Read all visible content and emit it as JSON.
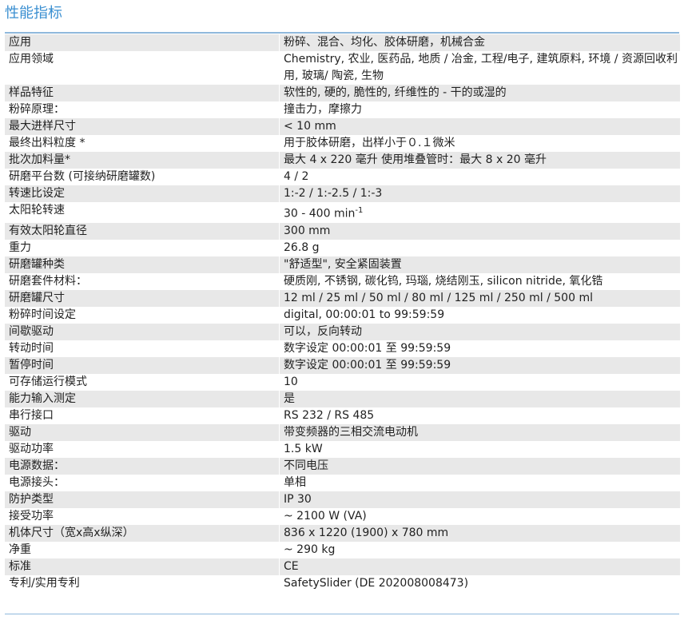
{
  "title": "性能指标",
  "rows": [
    {
      "label": "应用",
      "value": "粉碎、混合、均化、胶体研磨，机械合金"
    },
    {
      "label": "应用领域",
      "value": "Chemistry, 农业, 医药品, 地质 / 冶金, 工程/电子, 建筑原料, 环境 / 资源回收利用, 玻璃/ 陶瓷, 生物"
    },
    {
      "label": "样品特征",
      "value": "软性的, 硬的, 脆性的, 纤维性的 - 干的或湿的"
    },
    {
      "label": "粉碎原理：",
      "value": "撞击力，摩擦力"
    },
    {
      "label": "最大进样尺寸",
      "value": "< 10 mm"
    },
    {
      "label": "最终出料粒度 *",
      "value": "用于胶体研磨，出样小于０.１微米"
    },
    {
      "label": "批次加料量*",
      "value": "最大 4 x 220 毫升 使用堆叠管时：最大 8 x 20 毫升"
    },
    {
      "label": "研磨平台数 (可接纳研磨罐数)",
      "value": "4 / 2"
    },
    {
      "label": "转速比设定",
      "value": "1:-2 / 1:-2.5 / 1:-3"
    },
    {
      "label": "太阳轮转速",
      "value": "30 - 400 min",
      "sup": "-1"
    },
    {
      "label": "有效太阳轮直径",
      "value": "300 mm"
    },
    {
      "label": "重力",
      "value": "26.8 g"
    },
    {
      "label": "研磨罐种类",
      "value": "\"舒适型\", 安全紧固装置"
    },
    {
      "label": "研磨套件材料：",
      "value": "硬质刚, 不锈钢, 碳化钨, 玛瑙, 烧结刚玉, silicon nitride, 氧化锆"
    },
    {
      "label": "研磨罐尺寸",
      "value": "12 ml / 25 ml / 50 ml / 80 ml / 125 ml / 250 ml / 500 ml"
    },
    {
      "label": "粉碎时间设定",
      "value": "digital, 00:00:01 to 99:59:59"
    },
    {
      "label": "间歇驱动",
      "value": "可以，反向转动"
    },
    {
      "label": "转动时间",
      "value": "数字设定 00:00:01 至 99:59:59"
    },
    {
      "label": "暂停时间",
      "value": "数字设定 00:00:01 至 99:59:59"
    },
    {
      "label": "可存储运行模式",
      "value": "10"
    },
    {
      "label": "能力输入测定",
      "value": "是"
    },
    {
      "label": "串行接口",
      "value": "RS 232 / RS 485"
    },
    {
      "label": "驱动",
      "value": "带变频器的三相交流电动机"
    },
    {
      "label": "驱动功率",
      "value": "1.5 kW"
    },
    {
      "label": "电源数据：",
      "value": "不同电压"
    },
    {
      "label": "电源接头：",
      "value": "单相"
    },
    {
      "label": "防护类型",
      "value": "IP 30"
    },
    {
      "label": "接受功率",
      "value": "~ 2100 W (VA)"
    },
    {
      "label": "机体尺寸（宽x高x纵深）",
      "value": "836 x 1220 (1900) x 780 mm"
    },
    {
      "label": "净重",
      "value": "~ 290 kg"
    },
    {
      "label": "标准",
      "value": "CE"
    },
    {
      "label": "专利/实用专利",
      "value": "SafetySlider (DE 202008008473)"
    }
  ]
}
